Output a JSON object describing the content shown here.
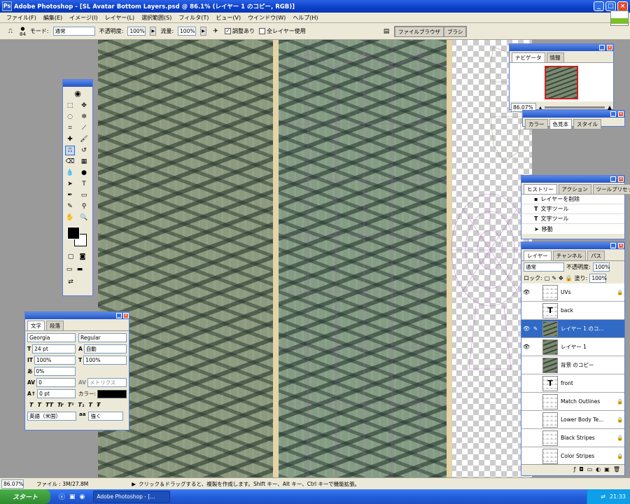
{
  "window": {
    "title": "Adobe Photoshop - [SL Avatar Bottom Layers.psd @ 86.1% (レイヤー 1 のコピー, RGB)]",
    "minimize": "_",
    "maximize": "□",
    "close": "×"
  },
  "menu": [
    "ファイル(F)",
    "編集(E)",
    "イメージ(I)",
    "レイヤー(L)",
    "選択範囲(S)",
    "フィルタ(T)",
    "ビュー(V)",
    "ウインドウ(W)",
    "ヘルプ(H)"
  ],
  "options": {
    "brush_size": "84",
    "mode_label": "モード:",
    "mode_value": "通常",
    "opacity_label": "不透明度:",
    "opacity_value": "100%",
    "flow_label": "流量:",
    "flow_value": "100%",
    "aligned_label": "調整あり",
    "all_layers_label": "全レイヤー使用",
    "well_tab1": "ファイルブラウザ",
    "well_tab2": "ブラシ"
  },
  "navigator": {
    "tab1": "ナビゲータ",
    "tab2": "情報",
    "zoom": "86.07%"
  },
  "color": {
    "tab1": "カラー",
    "tab2": "色見本",
    "tab3": "スタイル"
  },
  "history": {
    "tab1": "ヒストリー",
    "tab2": "アクション",
    "tab3": "ツールプリセット",
    "items": [
      "レイヤーを削除",
      "文字ツール",
      "文字ツール",
      "移動"
    ]
  },
  "layers": {
    "tab1": "レイヤー",
    "tab2": "チャンネル",
    "tab3": "パス",
    "blend": "通常",
    "opacity_label": "不透明度:",
    "opacity": "100%",
    "lock_label": "ロック:",
    "fill_label": "塗り:",
    "fill": "100%",
    "items": [
      {
        "name": "UVs"
      },
      {
        "name": "back"
      },
      {
        "name": "レイヤー 1 のコ..."
      },
      {
        "name": "レイヤー 1"
      },
      {
        "name": "背景 のコピー"
      },
      {
        "name": "front"
      },
      {
        "name": "Match Outlines"
      },
      {
        "name": "Lower Body Te..."
      },
      {
        "name": "Black Stripes"
      },
      {
        "name": "Color Stripes"
      }
    ]
  },
  "character": {
    "tab1": "文字",
    "tab2": "段落",
    "font": "Georgia",
    "style": "Regular",
    "size": "24 pt",
    "leading": "自動",
    "vscale": "100%",
    "hscale": "100%",
    "tracking": "0%",
    "kerning": "0",
    "kern_mode": "メトリクス",
    "baseline": "0 pt",
    "color_label": "カラー:",
    "language": "英語（米国）",
    "aa_label": "aa",
    "aa": "強く"
  },
  "status": {
    "zoom": "86.07%",
    "file": "ファイル : 3M/27.8M",
    "hint": "クリック＆ドラッグすると、複製を作成します。Shift キー、Alt キー、Ctrl キーで機能拡張。"
  },
  "taskbar": {
    "start": "スタート",
    "task": "Adobe Photoshop - [...",
    "time": "21:33"
  },
  "colors": {
    "accent": "#316ac5",
    "titlebar": "#0a3fc6"
  }
}
